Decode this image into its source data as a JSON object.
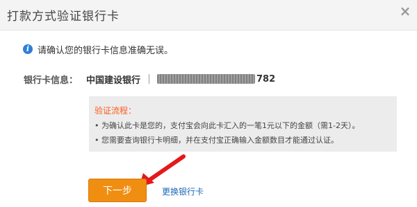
{
  "dialog": {
    "title": "打款方式验证银行卡",
    "close_icon": "close-icon"
  },
  "notice": {
    "icon": "info-icon",
    "text": "请确认您的银行卡信息准确无误。"
  },
  "card_info": {
    "label": "银行卡信息：",
    "bank_name": "中国建设银行",
    "card_number_suffix": "782"
  },
  "process": {
    "title": "验证流程：",
    "lines": [
      "• 为确认此卡是您的，支付宝会向此卡汇入的一笔1元以下的金额（需1-2天）。",
      "• 您需要查询银行卡明细，并在支付宝正确输入金额数目才能通过认证。"
    ]
  },
  "actions": {
    "next_label": "下一步",
    "change_card_label": "更换银行卡"
  },
  "colors": {
    "accent_button": "#f08e12",
    "link": "#1a67b8",
    "process_title": "#ff5a1f",
    "annotation_arrow": "#e3191c"
  }
}
